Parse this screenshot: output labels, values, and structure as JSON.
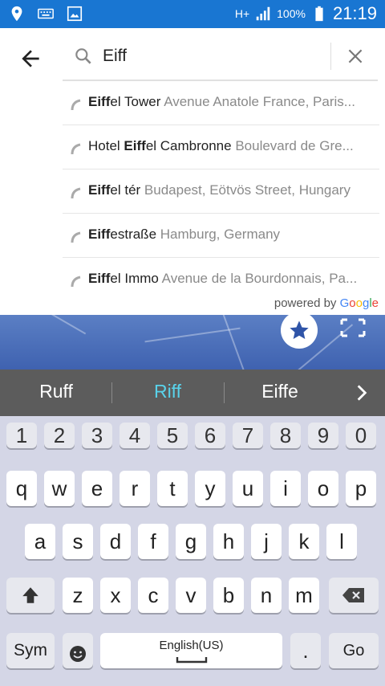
{
  "status_bar": {
    "network": "H+",
    "battery": "100%",
    "time": "21:19"
  },
  "search": {
    "query": "Eiff"
  },
  "suggestions": [
    {
      "bold_pre": "",
      "bold": "Eiff",
      "rest": "el Tower",
      "secondary": "Avenue Anatole France, Paris..."
    },
    {
      "bold_pre": "Hotel ",
      "bold": "Eiff",
      "rest": "el Cambronne",
      "secondary": "Boulevard de Gre..."
    },
    {
      "bold_pre": "",
      "bold": "Eiff",
      "rest": "el tér",
      "secondary": "Budapest, Eötvös Street, Hungary"
    },
    {
      "bold_pre": "",
      "bold": "Eiff",
      "rest": "estraße",
      "secondary": "Hamburg, Germany"
    },
    {
      "bold_pre": "",
      "bold": "Eiff",
      "rest": "el Immo",
      "secondary": "Avenue de la Bourdonnais, Pa..."
    }
  ],
  "powered_by": {
    "prefix": "powered by",
    "g1": "G",
    "o1": "o",
    "o2": "o",
    "g2": "g",
    "l": "l",
    "e": "e"
  },
  "predictions": [
    "Ruff",
    "Riff",
    "Eiffe"
  ],
  "keyboard": {
    "numbers": [
      "1",
      "2",
      "3",
      "4",
      "5",
      "6",
      "7",
      "8",
      "9",
      "0"
    ],
    "row1": [
      "q",
      "w",
      "e",
      "r",
      "t",
      "y",
      "u",
      "i",
      "o",
      "p"
    ],
    "row2": [
      "a",
      "s",
      "d",
      "f",
      "g",
      "h",
      "j",
      "k",
      "l"
    ],
    "row3": [
      "z",
      "x",
      "c",
      "v",
      "b",
      "n",
      "m"
    ],
    "sym_label": "Sym",
    "space_label": "English(US)",
    "period": ".",
    "go_label": "Go"
  },
  "colors": {
    "status_bar": "#1976d2",
    "prediction_highlight": "#59d2ea",
    "map": "#4a6cb8"
  }
}
